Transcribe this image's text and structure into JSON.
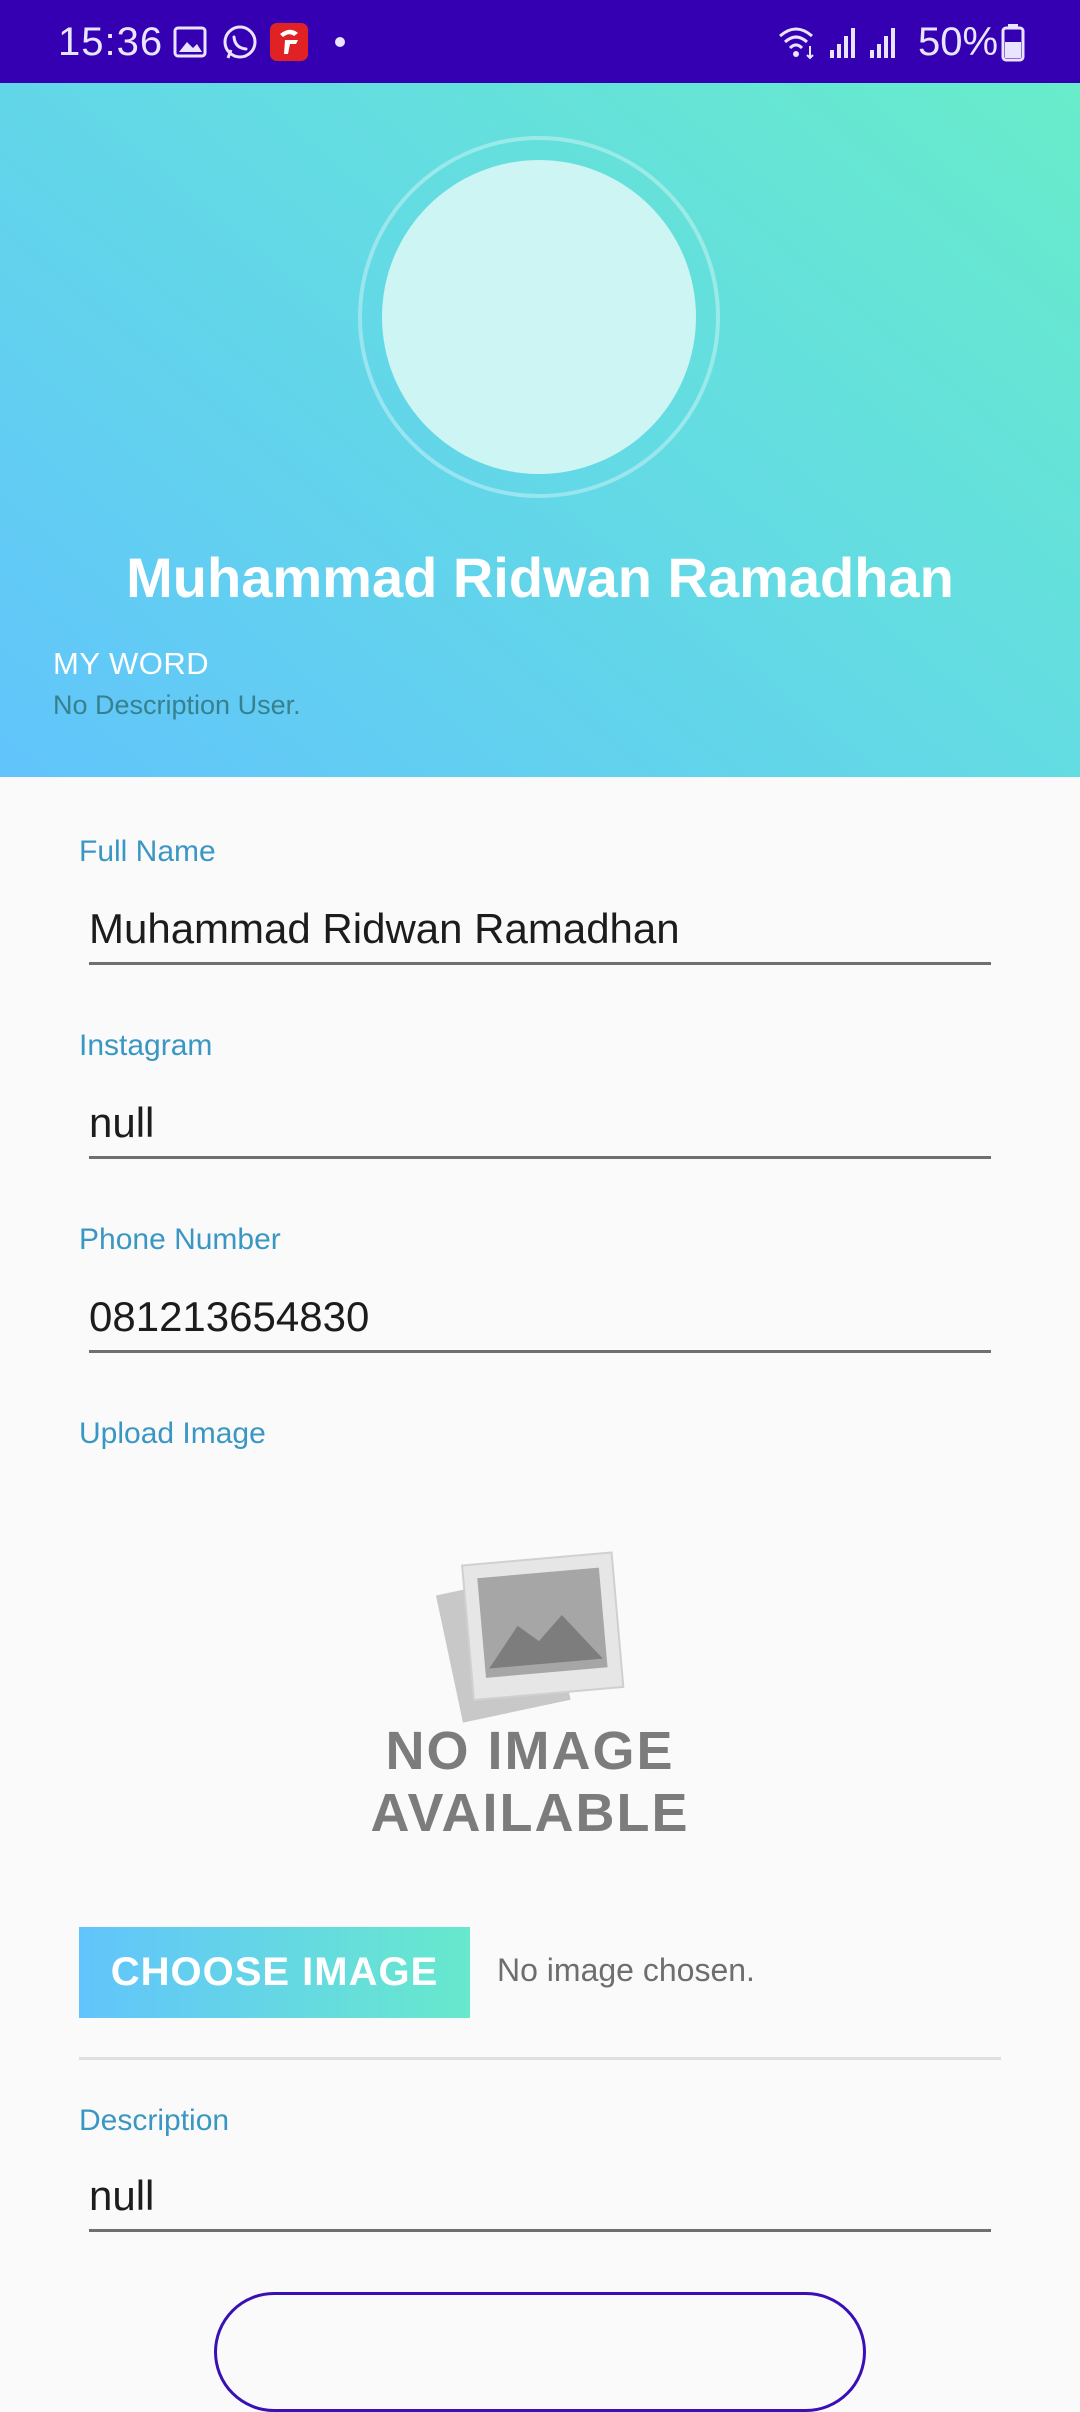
{
  "status_bar": {
    "time": "15:36",
    "battery": "50%",
    "icons": [
      "gallery-icon",
      "whatsapp-icon",
      "telkomsel-icon",
      "dot-icon",
      "wifi-icon",
      "signal-icon",
      "signal-icon",
      "battery-icon"
    ]
  },
  "profile": {
    "name": "Muhammad Ridwan Ramadhan",
    "my_word_label": "MY WORD",
    "my_word_description": "No Description User."
  },
  "form": {
    "full_name": {
      "label": "Full Name",
      "value": "Muhammad Ridwan Ramadhan"
    },
    "instagram": {
      "label": "Instagram",
      "value": "null"
    },
    "phone": {
      "label": "Phone Number",
      "value": "081213654830"
    },
    "upload": {
      "label": "Upload Image",
      "placeholder_line1": "NO IMAGE",
      "placeholder_line2": "AVAILABLE",
      "button_label": "CHOOSE IMAGE",
      "status": "No image chosen."
    },
    "description": {
      "label": "Description",
      "value": "null"
    }
  },
  "colors": {
    "status_bar": "#3500b2",
    "header_gradient_start": "#61c4fc",
    "header_gradient_end": "#68ecca",
    "label_blue": "#3a97c3",
    "save_button_border": "#3a10b6"
  }
}
